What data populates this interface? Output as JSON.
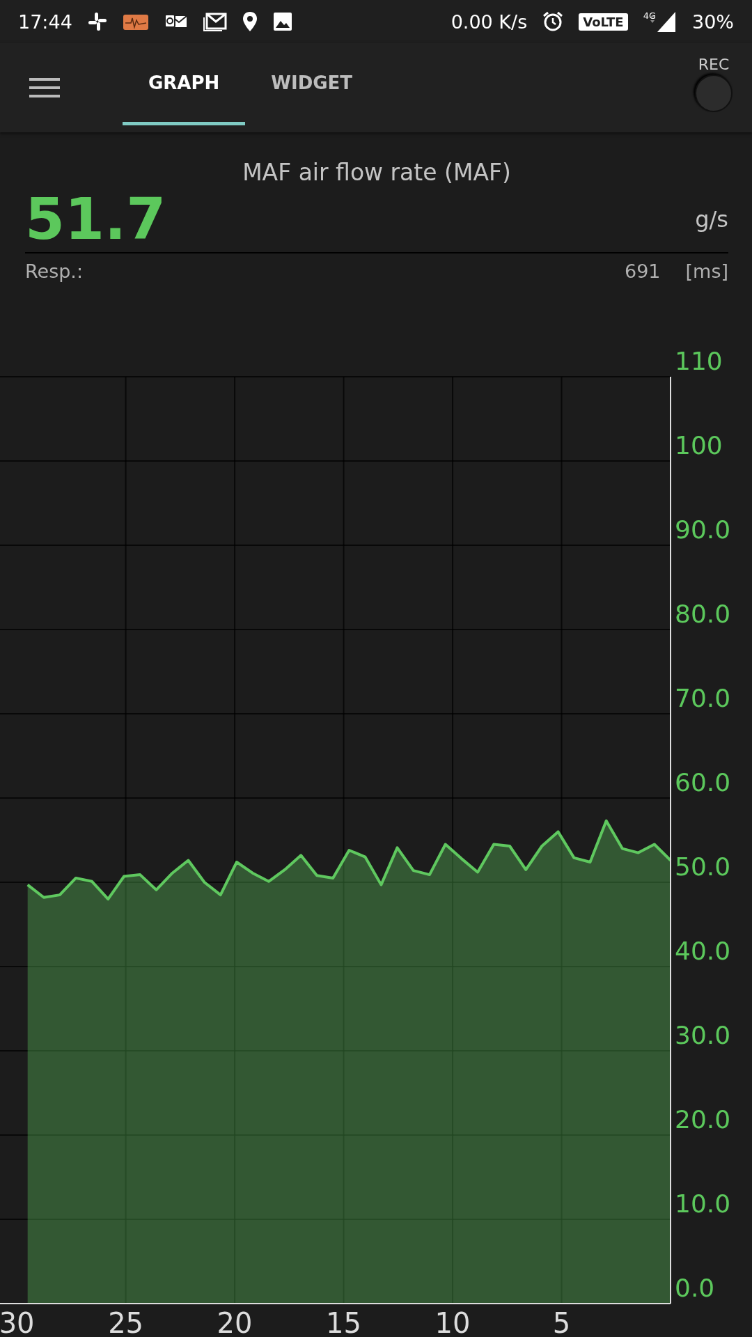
{
  "status_bar": {
    "time": "17:44",
    "network_speed": "0.00 K/s",
    "volte": "VoLTE",
    "network_type": "4G",
    "battery": "30%"
  },
  "app_bar": {
    "tabs": [
      {
        "label": "GRAPH",
        "selected": true
      },
      {
        "label": "WIDGET",
        "selected": false
      }
    ],
    "rec_label": "REC"
  },
  "sensor": {
    "title": "MAF air flow rate (MAF)",
    "value": "51.7",
    "unit": "g/s",
    "response_label": "Resp.:",
    "response_value": "691",
    "response_unit": "[ms]"
  },
  "chart_data": {
    "type": "area",
    "x": [
      29.5,
      28.76,
      28.03,
      27.29,
      26.55,
      25.81,
      25.08,
      24.34,
      23.6,
      22.86,
      22.13,
      21.39,
      20.65,
      19.91,
      19.18,
      18.44,
      17.7,
      16.96,
      16.23,
      15.49,
      14.75,
      14.01,
      13.28,
      12.54,
      11.8,
      11.06,
      10.33,
      9.59,
      8.85,
      8.11,
      7.38,
      6.64,
      5.9,
      5.16,
      4.43,
      3.69,
      2.95,
      2.21,
      1.48,
      0.74,
      0
    ],
    "series": [
      {
        "color": "#5fc85f",
        "values": [
          49.7,
          48.2,
          48.5,
          50.5,
          50.1,
          48.0,
          50.7,
          50.9,
          49.1,
          51.1,
          52.6,
          50.0,
          48.5,
          52.4,
          51.1,
          50.1,
          51.5,
          53.2,
          50.8,
          50.5,
          53.8,
          53.0,
          49.7,
          54.1,
          51.4,
          50.9,
          54.5,
          52.8,
          51.2,
          54.5,
          54.3,
          51.5,
          54.3,
          56.0,
          52.9,
          52.4,
          57.3,
          54.0,
          53.5,
          54.5,
          52.6
        ]
      }
    ],
    "xlim": [
      30.77,
      0
    ],
    "ylim": [
      0,
      110
    ],
    "xticks": [
      30,
      25,
      20,
      15,
      10,
      5
    ],
    "grid": true,
    "yticks": [
      {
        "value": 110,
        "label": "110"
      },
      {
        "value": 100,
        "label": "100"
      },
      {
        "value": 90,
        "label": "90.0"
      },
      {
        "value": 80,
        "label": "80.0"
      },
      {
        "value": 70,
        "label": "70.0"
      },
      {
        "value": 60,
        "label": "60.0"
      },
      {
        "value": 50,
        "label": "50.0"
      },
      {
        "value": 40,
        "label": "40.0"
      },
      {
        "value": 30,
        "label": "30.0"
      },
      {
        "value": 20,
        "label": "20.0"
      },
      {
        "value": 10,
        "label": "10.0"
      },
      {
        "value": 0,
        "label": "0.0"
      }
    ]
  }
}
